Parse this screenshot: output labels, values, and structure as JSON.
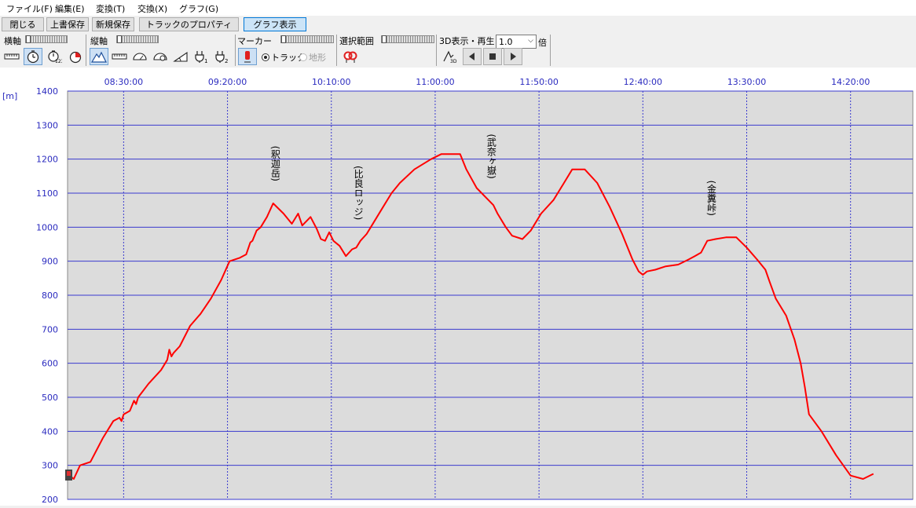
{
  "menu": [
    "ファイル(F)",
    "編集(E)",
    "変換(T)",
    "交換(X)",
    "グラフ(G)"
  ],
  "buttons": {
    "close": "閉じる",
    "overwrite": "上書保存",
    "save_new": "新規保存",
    "track_props": "トラックのプロパティ",
    "graph_view": "グラフ表示"
  },
  "toolbar": {
    "h_axis": "横軸",
    "v_axis": "縦軸",
    "marker": "マーカー",
    "radio_track": "トラック",
    "radio_terrain": "地形",
    "selection": "選択範囲",
    "play3d": "3D表示・再生",
    "speed_value": "1.0",
    "speed_unit": "倍",
    "icon_sub_123": "123",
    "icon_sub_1": "1",
    "icon_sub_2": "2",
    "icon_sub_3d": "3D"
  },
  "chart_data": {
    "type": "line",
    "ylabel": "[m]",
    "ylim": [
      200,
      1400
    ],
    "yticks": [
      200,
      300,
      400,
      500,
      600,
      700,
      800,
      900,
      1000,
      1100,
      1200,
      1300,
      1400
    ],
    "x_start": "08:03:00",
    "x_end": "14:50:00",
    "xticks": [
      "08:30:00",
      "09:20:00",
      "10:10:00",
      "11:00:00",
      "11:50:00",
      "12:40:00",
      "13:30:00",
      "14:20:00"
    ],
    "grid": true,
    "line_color": "#ff0000",
    "grid_color": "#3a3acf",
    "series": [
      {
        "time": [
          "08:04:00",
          "08:06:00",
          "08:09:00",
          "08:14:00",
          "08:20:00",
          "08:25:00",
          "08:28:00",
          "08:29:00",
          "08:30:00",
          "08:33:00",
          "08:35:00",
          "08:36:00",
          "08:37:00",
          "08:42:00",
          "08:48:00",
          "08:51:00",
          "08:52:00",
          "08:53:00",
          "08:54:00",
          "08:57:00",
          "09:02:00",
          "09:07:00",
          "09:12:00",
          "09:17:00",
          "09:21:00",
          "09:26:00",
          "09:29:00",
          "09:31:00",
          "09:32:00",
          "09:34:00",
          "09:36:00",
          "09:39:00",
          "09:42:00",
          "09:47:00",
          "09:51:00",
          "09:54:00",
          "09:56:00",
          "10:00:00",
          "10:03:00",
          "10:05:00",
          "10:07:00",
          "10:09:00",
          "10:11:00",
          "10:14:00",
          "10:17:00",
          "10:20:00",
          "10:22:00",
          "10:24:00",
          "10:27:00",
          "10:29:00",
          "10:32:00",
          "10:35:00",
          "10:39:00",
          "10:43:00",
          "10:50:00",
          "10:58:00",
          "11:03:00",
          "11:07:00",
          "11:12:00",
          "11:15:00",
          "11:20:00",
          "11:28:00",
          "11:30:00",
          "11:34:00",
          "11:37:00",
          "11:42:00",
          "11:46:00",
          "11:51:00",
          "11:57:00",
          "12:02:00",
          "12:06:00",
          "12:12:00",
          "12:18:00",
          "12:24:00",
          "12:30:00",
          "12:35:00",
          "12:38:00",
          "12:40:00",
          "12:42:00",
          "12:46:00",
          "12:51:00",
          "12:57:00",
          "13:02:00",
          "13:05:00",
          "13:08:00",
          "13:11:00",
          "13:15:00",
          "13:20:00",
          "13:25:00",
          "13:30:00",
          "13:35:00",
          "13:39:00",
          "13:41:00",
          "13:44:00",
          "13:49:00",
          "13:53:00",
          "13:56:00",
          "13:58:00",
          "14:00:00",
          "14:06:00",
          "14:13:00",
          "14:20:00",
          "14:26:00",
          "14:31:00",
          "14:38:00",
          "14:44:00",
          "14:47:00",
          "14:50:00"
        ],
        "values": [
          270,
          260,
          300,
          310,
          380,
          430,
          440,
          430,
          450,
          460,
          490,
          480,
          500,
          540,
          580,
          610,
          640,
          620,
          630,
          650,
          710,
          745,
          790,
          845,
          900,
          910,
          920,
          955,
          960,
          990,
          1000,
          1030,
          1070,
          1040,
          1010,
          1040,
          1005,
          1030,
          995,
          965,
          960,
          985,
          960,
          945,
          915,
          935,
          940,
          960,
          980,
          1000,
          1030,
          1060,
          1100,
          1130,
          1170,
          1200,
          1215,
          1215,
          1215,
          1170,
          1115,
          1065,
          1040,
          1000,
          975,
          965,
          990,
          1040,
          1080,
          1130,
          1170,
          1170,
          1130,
          1060,
          980,
          905,
          870,
          860,
          870,
          875,
          885,
          890,
          905,
          915,
          925,
          960,
          965,
          970,
          970,
          940,
          905,
          875,
          840,
          790,
          740,
          670,
          600,
          530,
          450,
          400,
          330,
          270,
          260,
          275
        ]
      }
    ],
    "annotations": [
      {
        "label": "(釈迦岳)",
        "time": "09:43:00"
      },
      {
        "label": "(比良ロッジ)",
        "time": "10:23:00"
      },
      {
        "label": "(武奈ヶ嶽)",
        "time": "11:27:00"
      },
      {
        "label": "(金糞峠)",
        "time": "13:13:00"
      }
    ]
  }
}
